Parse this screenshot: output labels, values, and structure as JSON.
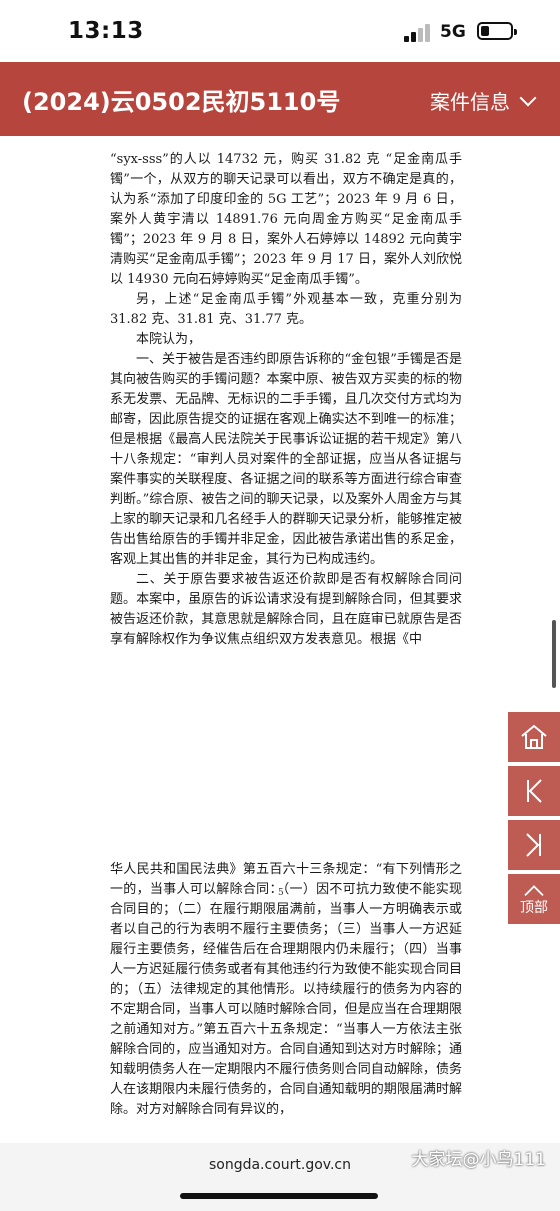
{
  "status_bar": {
    "time": "13:13",
    "network": "5G"
  },
  "header": {
    "case_number": "(2024)云0502民初5110号",
    "menu_label": "案件信息"
  },
  "page1": {
    "p1": "“syx-sss”的人以 14732 元，购买 31.82 克 “足金南瓜手镯”一个，从双方的聊天记录可以看出，双方不确定是真的，认为系“添加了印度印金的 5G 工艺”；2023 年 9 月 6 日，案外人黄宇清以 14891.76 元向周金方购买“足金南瓜手镯”；2023 年 9 月 8 日，案外人石婷婷以 14892 元向黄宇清购买“足金南瓜手镯”；2023 年 9 月 17 日，案外人刘欣悦以 14930 元向石婷婷购买“足金南瓜手镯”。",
    "p2": "另，上述“足金南瓜手镯”外观基本一致，克重分别为 31.82 克、31.81 克、31.77 克。",
    "p3": "本院认为，",
    "p4": "一、关于被告是否违约即原告诉称的“金包银”手镯是否是其向被告购买的手镯问题？本案中原、被告双方买卖的标的物系无发票、无品牌、无标识的二手手镯，且几次交付方式均为邮寄，因此原告提交的证据在客观上确实达不到唯一的标准；但是根据《最高人民法院关于民事诉讼证据的若干规定》第八十八条规定：“审判人员对案件的全部证据，应当从各证据与案件事实的关联程度、各证据之间的联系等方面进行综合审查判断。”综合原、被告之间的聊天记录，以及案外人周金方与其上家的聊天记录和几名经手人的群聊天记录分析，能够推定被告出售给原告的手镯并非足金，因此被告承诺出售的系足金，客观上其出售的并非足金，其行为已构成违约。",
    "p5": "二、关于原告要求被告返还价款即是否有权解除合同问题。本案中，虽原告的诉讼请求没有提到解除合同，但其要求被告返还价款，其意思就是解除合同，且在庭审已就原告是否享有解除权作为争议焦点组织双方发表意见。根据《中",
    "page_number": "5"
  },
  "page2": {
    "p1": "华人民共和国民法典》第五百六十三条规定：“有下列情形之一的，当事人可以解除合同：（一）因不可抗力致使不能实现合同目的；（二）在履行期限届满前，当事人一方明确表示或者以自己的行为表明不履行主要债务；（三）当事人一方迟延履行主要债务，经催告后在合理期限内仍未履行；（四）当事人一方迟延履行债务或者有其他违约行为致使不能实现合同目的；（五）法律规定的其他情形。以持续履行的债务为内容的不定期合同，当事人可以随时解除合同，但是应当在合理期限之前通知对方。”第五百六十五条规定：“当事人一方依法主张解除合同的，应当通知对方。合同自通知到达对方时解除；通知载明债务人在一定期限内不履行债务则合同自动解除，债务人在该期限内未履行债务的，合同自通知载明的期限届满时解除。对方对解除合同有异议的，"
  },
  "side_nav": {
    "top_label": "顶部"
  },
  "url_bar": {
    "url": "songda.court.gov.cn"
  },
  "watermark": "大家坛@小鸟111",
  "colors": {
    "accent": "#b6463d"
  }
}
